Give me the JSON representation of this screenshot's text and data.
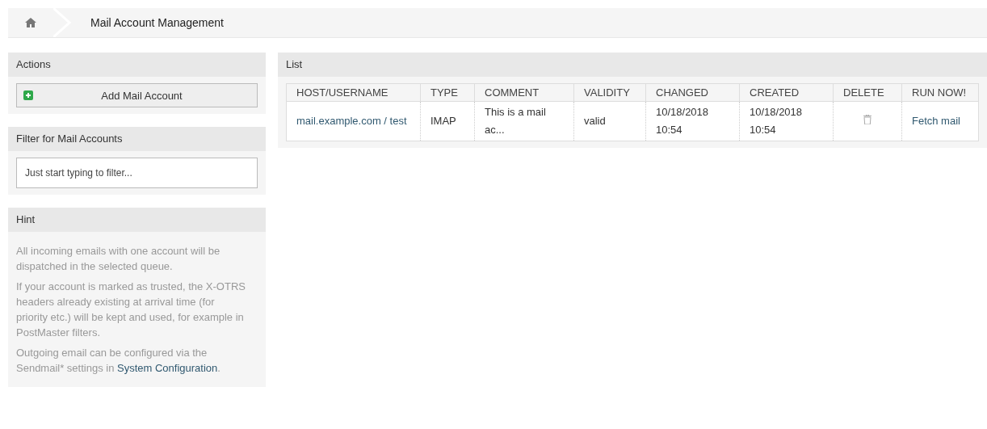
{
  "breadcrumb": {
    "title": "Mail Account Management"
  },
  "actions": {
    "title": "Actions",
    "buttons": [
      "Add Mail Account"
    ]
  },
  "filter": {
    "title": "Filter for Mail Accounts",
    "placeholder": "Just start typing to filter..."
  },
  "hint": {
    "title": "Hint",
    "paragraphs": [
      {
        "text": "All incoming emails with one account will be dispatched in the selected queue."
      },
      {
        "text": "If your account is marked as trusted, the X-OTRS headers already existing at arrival time (for priority etc.) will be kept and used, for example in PostMaster filters."
      },
      {
        "text": "Outgoing email can be configured via the Sendmail* settings in ",
        "link": "System Configuration",
        "after": "."
      }
    ]
  },
  "list": {
    "title": "List",
    "columns": [
      "HOST/USERNAME",
      "TYPE",
      "COMMENT",
      "VALIDITY",
      "CHANGED",
      "CREATED",
      "DELETE",
      "RUN NOW!"
    ],
    "rows": [
      {
        "host": "mail.example.com / test",
        "type": "IMAP",
        "comment": "This is a mail ac...",
        "validity": "valid",
        "changed": "10/18/2018 10:54",
        "created": "10/18/2018 10:54",
        "run": "Fetch mail"
      }
    ]
  }
}
